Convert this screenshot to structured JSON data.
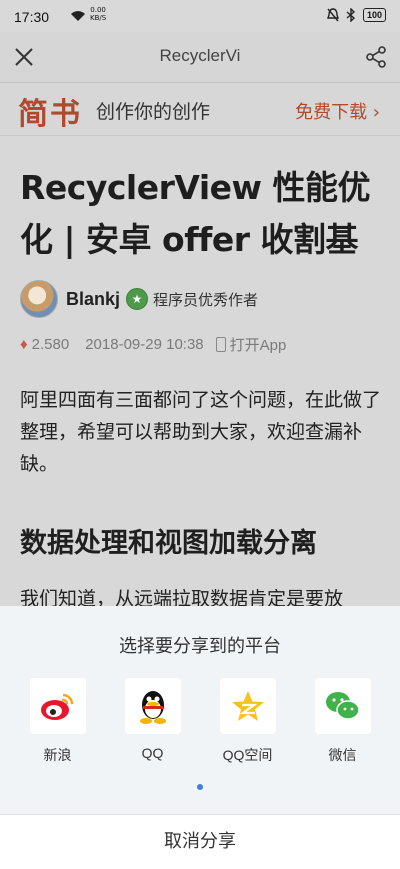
{
  "status_bar": {
    "time": "17:30",
    "net_speed_value": "0.00",
    "net_speed_unit": "KB/S",
    "battery": "100"
  },
  "nav": {
    "title": "RecyclerVi"
  },
  "banner": {
    "logo": "简书",
    "slogan": "创作你的创作",
    "download": "免费下载 ›"
  },
  "article": {
    "title": "RecyclerView 性能优化 | 安卓 offer 收割基",
    "author_name": "Blankj",
    "author_role": "程序员优秀作者",
    "diamonds": "2.580",
    "date": "2018-09-29 10:38",
    "open_app": "打开App",
    "intro": "阿里四面有三面都问了这个问题，在此做了整理，希望可以帮助到大家，欢迎查漏补缺。",
    "section_heading": "数据处理和视图加载分离",
    "next_paragraph": "我们知道，从远端拉取数据肯定是要放"
  },
  "share_sheet": {
    "heading": "选择要分享到的平台",
    "platforms": [
      {
        "label": "新浪",
        "icon": "weibo-icon"
      },
      {
        "label": "QQ",
        "icon": "qq-icon"
      },
      {
        "label": "QQ空间",
        "icon": "qzone-icon"
      },
      {
        "label": "微信",
        "icon": "wechat-icon"
      }
    ],
    "cancel": "取消分享"
  },
  "colors": {
    "brand": "#b04a2f",
    "page_indicator": "#3d7fd9"
  }
}
